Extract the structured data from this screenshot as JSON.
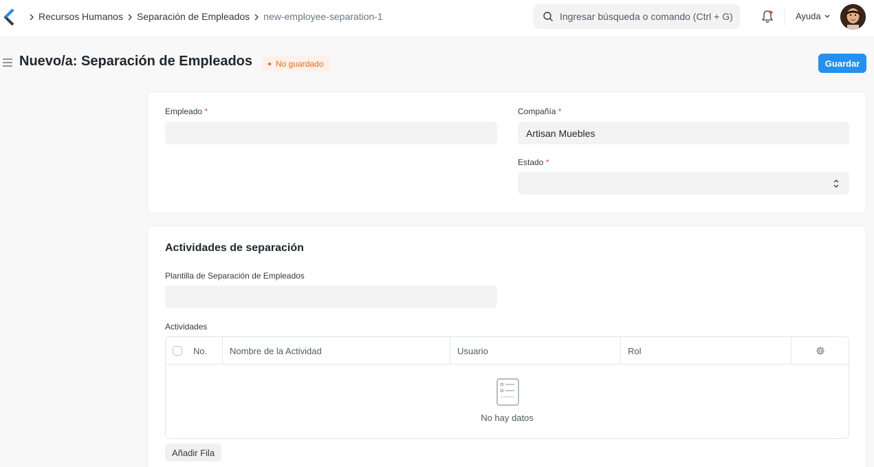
{
  "breadcrumb": [
    "Recursos Humanos",
    "Separación de Empleados",
    "new-employee-separation-1"
  ],
  "search": {
    "placeholder": "Ingresar búsqueda o comando (Ctrl + G)"
  },
  "navbar": {
    "help_label": "Ayuda"
  },
  "page": {
    "title": "Nuevo/a: Separación de Empleados",
    "status_badge": "No guardado",
    "save_label": "Guardar"
  },
  "form": {
    "employee": {
      "label": "Empleado",
      "required": "*",
      "value": ""
    },
    "company": {
      "label": "Compañía",
      "required": "*",
      "value": "Artisan Muebles"
    },
    "status": {
      "label": "Estado",
      "required": "*",
      "value": ""
    }
  },
  "activities_section": {
    "title": "Actividades de separación",
    "template": {
      "label": "Plantilla de Separación de Empleados",
      "value": ""
    },
    "table_label": "Actividades",
    "columns": [
      "No.",
      "Nombre de la Actividad",
      "Usuario",
      "Rol"
    ],
    "empty_text": "No hay datos",
    "add_row_label": "Añadir Fila"
  },
  "colors": {
    "primary": "#2490ef",
    "badge_text": "#e86c13",
    "badge_bg": "#fff1ea",
    "required": "#e24c4c"
  },
  "icons": [
    "logo-icon",
    "chevron-right-icon",
    "search-icon",
    "bell-icon",
    "chevron-down-icon",
    "menu-icon",
    "select-arrows-icon",
    "gear-icon",
    "empty-list-icon"
  ]
}
